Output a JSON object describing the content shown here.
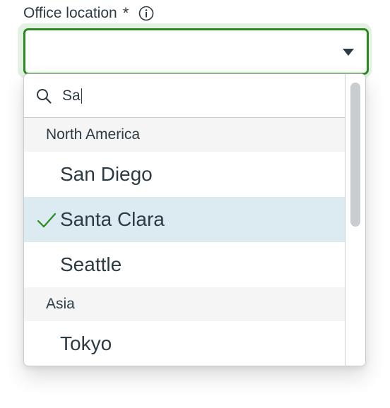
{
  "field": {
    "label": "Office location",
    "required_mark": "*",
    "info_icon": "info-icon",
    "selected_value": "",
    "caret_icon": "caret-down-icon"
  },
  "search": {
    "icon": "search-icon",
    "value": "Sa"
  },
  "groups": [
    {
      "label": "North America",
      "options": [
        {
          "label": "San Diego",
          "selected": false
        },
        {
          "label": "Santa Clara",
          "selected": true
        },
        {
          "label": "Seattle",
          "selected": false
        }
      ]
    },
    {
      "label": "Asia",
      "options": [
        {
          "label": "Tokyo",
          "selected": false
        }
      ]
    }
  ],
  "colors": {
    "focus_border": "#2a8a1f",
    "focus_ring": "#e3f1e2",
    "selected_bg": "#dcebf1",
    "check": "#2a8a1f",
    "text": "#2d3b45"
  }
}
